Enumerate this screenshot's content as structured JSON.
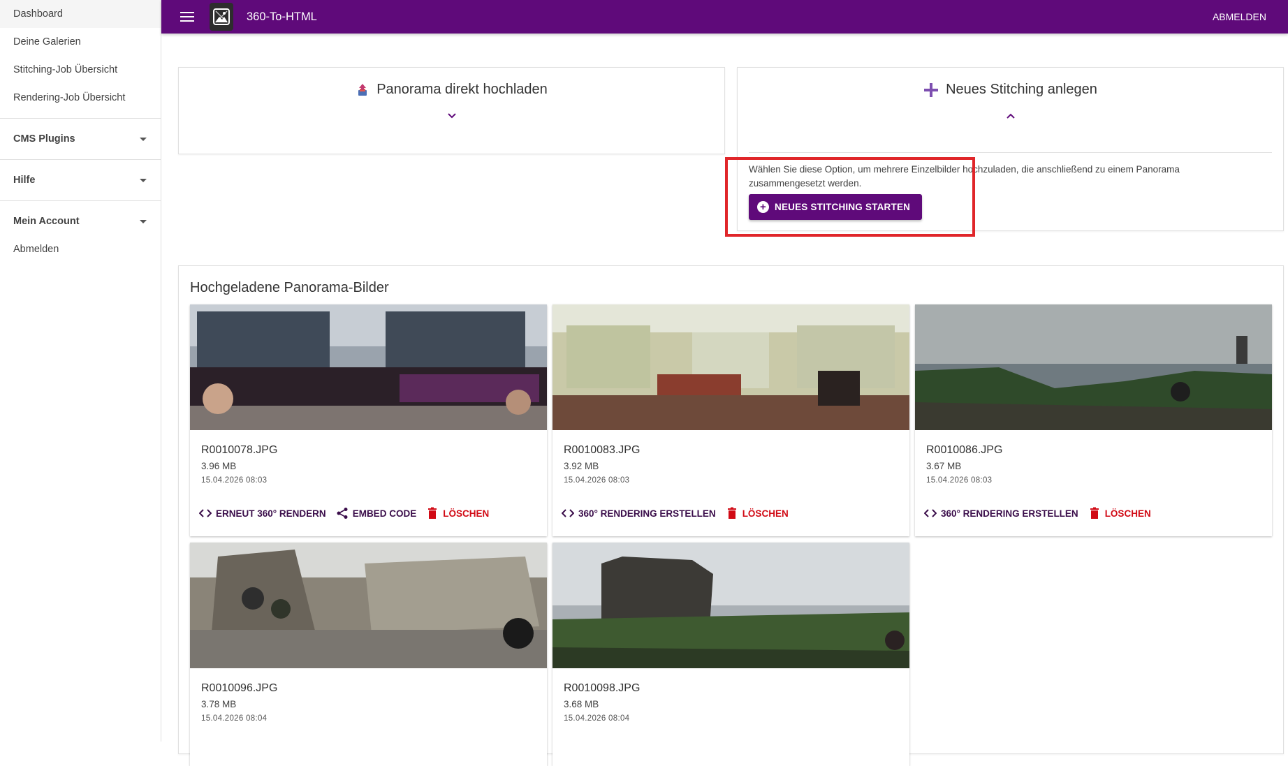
{
  "sidebar": {
    "links": [
      {
        "label": "Dashboard"
      },
      {
        "label": "Deine Galerien"
      },
      {
        "label": "Stitching-Job Übersicht"
      },
      {
        "label": "Rendering-Job Übersicht"
      }
    ],
    "groups": [
      {
        "label": "CMS Plugins"
      },
      {
        "label": "Hilfe"
      },
      {
        "label": "Mein Account"
      }
    ],
    "account_link": "Abmelden"
  },
  "topbar": {
    "title": "360-To-HTML",
    "logout": "ABMELDEN",
    "color": "#5f0a7a"
  },
  "upload_card": {
    "title": "Panorama direkt hochladen",
    "icon": "upload-icon"
  },
  "stitch_card": {
    "title": "Neues Stitching anlegen",
    "icon": "plus-icon",
    "description": "Wählen Sie diese Option, um mehrere Einzelbilder hochzuladen, die anschließend zu einem Panorama zusammengesetzt werden.",
    "button": "NEUES STITCHING STARTEN"
  },
  "gallery": {
    "title": "Hochgeladene Panorama-Bilder",
    "images": [
      {
        "file": "R0010078.JPG",
        "size": "3.96 MB",
        "date": "15.04.2026 08:03",
        "actions": [
          {
            "label": "ERNEUT 360° RENDERN",
            "icon": "code-icon"
          },
          {
            "label": "EMBED CODE",
            "icon": "share-icon"
          },
          {
            "label": "LÖSCHEN",
            "icon": "trash-icon"
          }
        ]
      },
      {
        "file": "R0010083.JPG",
        "size": "3.92 MB",
        "date": "15.04.2026 08:03",
        "actions": [
          {
            "label": "360° RENDERING ERSTELLEN",
            "icon": "code-icon"
          },
          {
            "label": "LÖSCHEN",
            "icon": "trash-icon"
          }
        ]
      },
      {
        "file": "R0010086.JPG",
        "size": "3.67 MB",
        "date": "15.04.2026 08:03",
        "actions": [
          {
            "label": "360° RENDERING ERSTELLEN",
            "icon": "code-icon"
          },
          {
            "label": "LÖSCHEN",
            "icon": "trash-icon"
          }
        ]
      },
      {
        "file": "R0010096.JPG",
        "size": "3.78 MB",
        "date": "15.04.2026 08:04",
        "actions": []
      },
      {
        "file": "R0010098.JPG",
        "size": "3.68 MB",
        "date": "15.04.2026 08:04",
        "actions": []
      }
    ]
  },
  "colors": {
    "primary": "#5f0a7a",
    "danger": "#d10a15",
    "highlight": "#e0262a"
  }
}
